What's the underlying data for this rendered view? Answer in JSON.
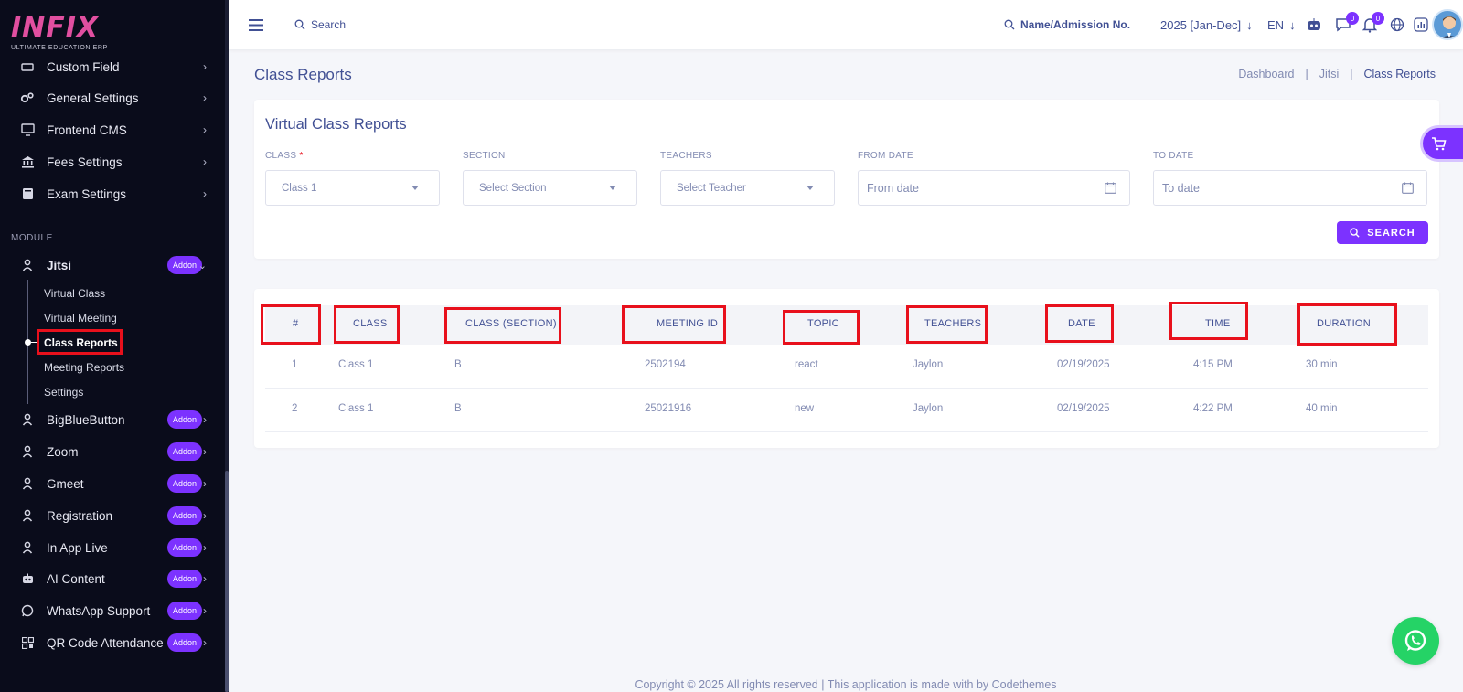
{
  "brand": {
    "logo_text": "INFIX",
    "tagline": "ULTIMATE EDUCATION ERP"
  },
  "sidebar": {
    "top_items": [
      {
        "label": "Custom Field",
        "icon": "custom-field-icon"
      },
      {
        "label": "General Settings",
        "icon": "gears-icon"
      },
      {
        "label": "Frontend CMS",
        "icon": "monitor-icon"
      },
      {
        "label": "Fees Settings",
        "icon": "bank-icon"
      },
      {
        "label": "Exam Settings",
        "icon": "book-icon"
      }
    ],
    "module_label": "MODULE",
    "jitsi": {
      "label": "Jitsi",
      "badge": "Addon",
      "sub_items": [
        "Virtual Class",
        "Virtual Meeting",
        "Class Reports",
        "Meeting Reports",
        "Settings"
      ]
    },
    "modules": [
      {
        "label": "BigBlueButton",
        "badge": "Addon"
      },
      {
        "label": "Zoom",
        "badge": "Addon"
      },
      {
        "label": "Gmeet",
        "badge": "Addon"
      },
      {
        "label": "Registration",
        "badge": "Addon"
      },
      {
        "label": "In App Live",
        "badge": "Addon"
      },
      {
        "label": "AI Content",
        "badge": "Addon"
      },
      {
        "label": "WhatsApp Support",
        "badge": "Addon"
      },
      {
        "label": "QR Code Attendance",
        "badge": "Addon"
      }
    ]
  },
  "header": {
    "search_label": "Search",
    "student_search_label": "Name/Admission No.",
    "session": "2025 [Jan-Dec]",
    "language": "EN",
    "messages_count": "0",
    "notifications_count": "0"
  },
  "page": {
    "title": "Class Reports",
    "breadcrumb": [
      "Dashboard",
      "Jitsi",
      "Class Reports"
    ]
  },
  "filters": {
    "title": "Virtual Class Reports",
    "class_label": "CLASS",
    "required_mark": "*",
    "class_value": "Class 1",
    "section_label": "SECTION",
    "section_value": "Select Section",
    "teachers_label": "TEACHERS",
    "teachers_value": "Select Teacher",
    "from_label": "FROM DATE",
    "from_placeholder": "From date",
    "to_label": "TO DATE",
    "to_placeholder": "To date",
    "search_button": "SEARCH"
  },
  "table": {
    "headers": [
      "#",
      "CLASS",
      "CLASS (SECTION)",
      "MEETING ID",
      "TOPIC",
      "TEACHERS",
      "DATE",
      "TIME",
      "DURATION"
    ],
    "rows": [
      [
        "1",
        "Class 1",
        "B",
        "2502194",
        "react",
        "Jaylon",
        "02/19/2025",
        "4:15 PM",
        "30 min"
      ],
      [
        "2",
        "Class 1",
        "B",
        "25021916",
        "new",
        "Jaylon",
        "02/19/2025",
        "4:22 PM",
        "40 min"
      ]
    ]
  },
  "footer": {
    "text": "Copyright © 2025 All rights reserved | This application is made with by Codethemes"
  },
  "colors": {
    "sidebar_bg": "#0a0c1b",
    "accent": "#7c32ff",
    "text": "#415094",
    "muted": "#828bb2",
    "highlight": "#e8101c",
    "whatsapp": "#25d366"
  }
}
